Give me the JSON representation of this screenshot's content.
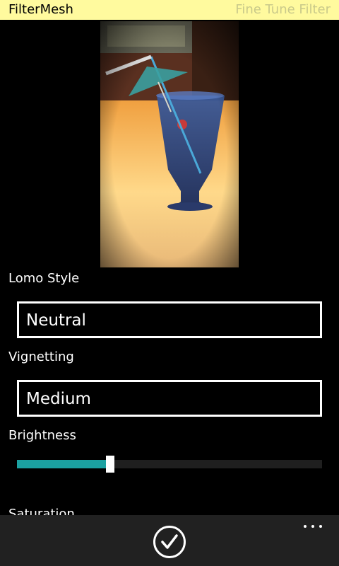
{
  "header": {
    "app_title": "FilterMesh",
    "page_title": "Fine Tune Filter",
    "background_color": "#fffa9e"
  },
  "controls": {
    "lomo_style": {
      "label": "Lomo Style",
      "value": "Neutral"
    },
    "vignetting": {
      "label": "Vignetting",
      "value": "Medium"
    },
    "brightness": {
      "label": "Brightness",
      "level": 0.3,
      "accent_color": "#1ba1a1"
    },
    "saturation": {
      "label": "Saturation"
    }
  },
  "appbar": {
    "confirm_icon": "check-circle-icon",
    "more_icon": "ellipsis-icon",
    "background_color": "#212121"
  }
}
